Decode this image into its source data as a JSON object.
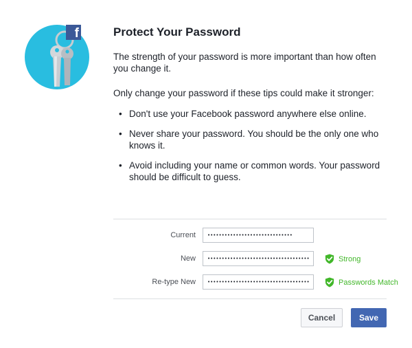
{
  "logo": {
    "brand_letter": "f"
  },
  "heading": {
    "title": "Protect Your Password"
  },
  "intro": "The strength of your password is more important than how often you change it.",
  "tips_intro": "Only change your password if these tips could make it stronger:",
  "tips": [
    "Don't use your Facebook password anywhere else online.",
    "Never share your password. You should be the only one who knows it.",
    "Avoid including your name or common words. Your password should be difficult to guess."
  ],
  "form": {
    "current": {
      "label": "Current",
      "value": "••••••••••••••••••••••••••••••"
    },
    "new": {
      "label": "New",
      "value": "••••••••••••••••••••••••••••••••••••",
      "status": "Strong"
    },
    "retype": {
      "label": "Re-type New",
      "value": "••••••••••••••••••••••••••••••••••••",
      "status": "Passwords Match"
    }
  },
  "buttons": {
    "cancel": "Cancel",
    "save": "Save"
  },
  "colors": {
    "accent": "#4267b2",
    "success": "#42b72a",
    "logo_bg": "#29bde0"
  },
  "icons": {
    "logo": "keys-icon",
    "status": "shield-check-icon"
  }
}
